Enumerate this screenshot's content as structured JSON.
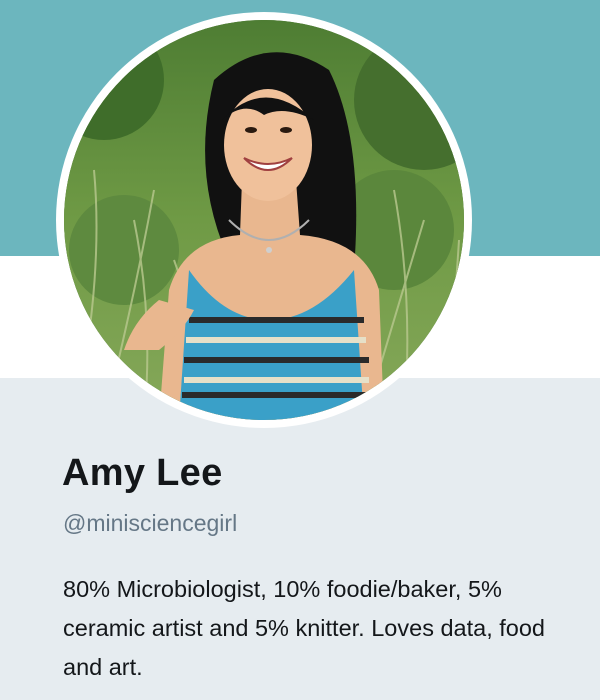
{
  "profile": {
    "display_name": "Amy Lee",
    "handle": "@minisciencegirl",
    "bio": "80% Microbiologist, 10% foodie/baker, 5% ceramic artist and 5% knitter. Loves data, food and art."
  },
  "colors": {
    "banner": "#6cb6be",
    "background": "#e6ecf0",
    "name_text": "#14171a",
    "handle_text": "#657786"
  },
  "avatar": {
    "alt": "Profile photo of a smiling woman in a striped dress standing in tall grass"
  }
}
